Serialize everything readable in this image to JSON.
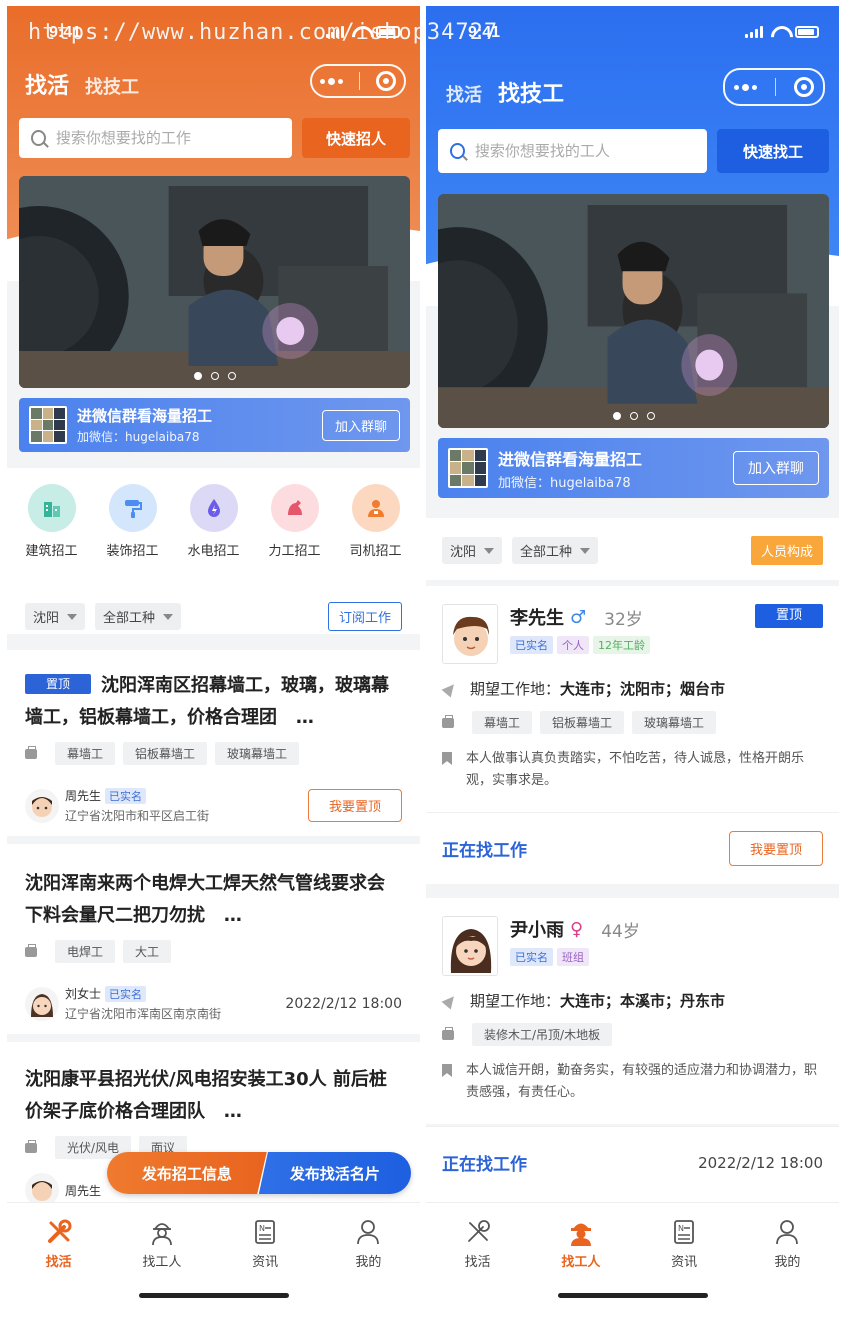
{
  "watermark": "https://www.huzhan.com/ishop34727",
  "colors": {
    "orange": "#e8641f",
    "blue": "#1d5fe0"
  },
  "left": {
    "status_time": "9:41",
    "tab_active": "找活",
    "tab_inactive": "找技工",
    "search_placeholder": "搜索你想要找的工作",
    "quick_button": "快速招人",
    "wx_title": "进微信群看海量招工",
    "wx_sub": "加微信：hugelaiba78",
    "wx_button": "加入群聊",
    "categories": [
      {
        "label": "建筑招工",
        "icon": "building-icon",
        "color": "#bfe8e0"
      },
      {
        "label": "装饰招工",
        "icon": "paint-roller-icon",
        "color": "#cfe2fb"
      },
      {
        "label": "水电招工",
        "icon": "water-drop-icon",
        "color": "#d9d6f7"
      },
      {
        "label": "力工招工",
        "icon": "muscle-icon",
        "color": "#fbd9dc"
      },
      {
        "label": "司机招工",
        "icon": "driver-icon",
        "color": "#fbd6bf"
      }
    ],
    "filter_city": "沈阳",
    "filter_type": "全部工种",
    "subscribe": "订阅工作",
    "jobs": [
      {
        "badge": "置顶",
        "title": "沈阳浑南区招幕墙工，玻璃，玻璃幕墙工，铝板幕墙工，价格合理团",
        "ellipsis": "…",
        "tags": [
          "幕墙工",
          "铝板幕墙工",
          "玻璃幕墙工"
        ],
        "name": "周先生",
        "verified": "已实名",
        "addr": "辽宁省沈阳市和平区启工街",
        "action": "我要置顶"
      },
      {
        "title": "沈阳浑南来两个电焊大工焊天然气管线要求会下料会量尺二把刀勿扰",
        "ellipsis": "…",
        "tags": [
          "电焊工",
          "大工"
        ],
        "name": "刘女士",
        "verified": "已实名",
        "addr": "辽宁省沈阳市浑南区南京南街",
        "time": "2022/2/12 18:00"
      },
      {
        "title": "沈阳康平县招光伏/风电招安装工30人 前后桩价架子底价格合理团队",
        "ellipsis": "…",
        "tags": [
          "光伏/风电",
          "面议"
        ],
        "name": "周先生"
      }
    ],
    "float_post_job": "发布招工信息",
    "float_post_card": "发布找活名片",
    "tabbar": [
      "找活",
      "找工人",
      "资讯",
      "我的"
    ]
  },
  "right": {
    "status_time": "9:41",
    "tab_inactive": "找活",
    "tab_active": "找技工",
    "search_placeholder": "搜索你想要找的工人",
    "quick_button": "快速找工",
    "wx_title": "进微信群看海量招工",
    "wx_sub": "加微信：hugelaiba78",
    "wx_button": "加入群聊",
    "filter_city": "沈阳",
    "filter_type": "全部工种",
    "people_button": "人员构成",
    "workers": [
      {
        "name": "李先生",
        "gender": "♂",
        "age": "32岁",
        "badges": [
          "已实名",
          "个人",
          "12年工龄"
        ],
        "top": "置顶",
        "loc_label": "期望工作地：",
        "loc_value": "大连市；沈阳市；烟台市",
        "tags": [
          "幕墙工",
          "铝板幕墙工",
          "玻璃幕墙工"
        ],
        "desc": "本人做事认真负责踏实，不怕吃苦，待人诚恳，性格开朗乐观，实事求是。",
        "status": "正在找工作",
        "action": "我要置顶"
      },
      {
        "name": "尹小雨",
        "gender": "♀",
        "age": "44岁",
        "badges": [
          "已实名",
          "班组"
        ],
        "loc_label": "期望工作地：",
        "loc_value": "大连市；本溪市；丹东市",
        "tags": [
          "装修木工/吊顶/木地板"
        ],
        "desc": "本人诚信开朗，勤奋务实，有较强的适应潜力和协调潜力，职责感强，有责任心。",
        "status": "正在找工作",
        "time": "2022/2/12 18:00"
      }
    ],
    "tabbar": [
      "找活",
      "找工人",
      "资讯",
      "我的"
    ]
  }
}
